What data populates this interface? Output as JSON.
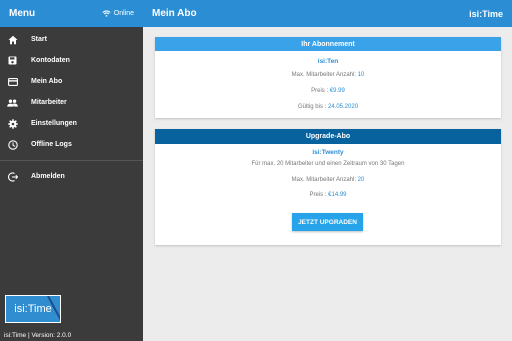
{
  "sidebar": {
    "title": "Menu",
    "status": "Online",
    "items": [
      {
        "label": "Start",
        "icon": "home-icon"
      },
      {
        "label": "Kontodaten",
        "icon": "save-icon"
      },
      {
        "label": "Mein Abo",
        "icon": "card-icon"
      },
      {
        "label": "Mitarbeiter",
        "icon": "people-icon"
      },
      {
        "label": "Einstellungen",
        "icon": "gear-icon"
      },
      {
        "label": "Offline Logs",
        "icon": "clock-icon"
      },
      {
        "label": "Abmelden",
        "icon": "logout-icon"
      }
    ],
    "logo_text": "isi:Time",
    "version": "isi:Time | Version: 2.0.0"
  },
  "header": {
    "title": "Mein Abo",
    "brand": "isi:Time"
  },
  "current_plan": {
    "heading": "Ihr Abonnement",
    "name": "isi:Ten",
    "employees_label": "Max. Mitarbeiter Anzahl:",
    "employees_value": "10",
    "price_label": "Preis :",
    "price_value": "€9.99",
    "valid_label": "Gültig bis :",
    "valid_value": "24.05.2020"
  },
  "upgrade_plan": {
    "heading": "Upgrade-Abo",
    "name": "isi:Twenty",
    "description": "Für max. 20 Mitarbeiter und einen Zeitraum von 30 Tagen",
    "employees_label": "Max. Mitarbeiter Anzahl:",
    "employees_value": "20",
    "price_label": "Preis :",
    "price_value": "€14.99",
    "button_label": "JETZT UPGRADEN"
  },
  "colors": {
    "accent": "#2b8ed4",
    "sidebar": "#3b3b3b",
    "upgrade_header": "#07629d",
    "button": "#26a3e9"
  }
}
